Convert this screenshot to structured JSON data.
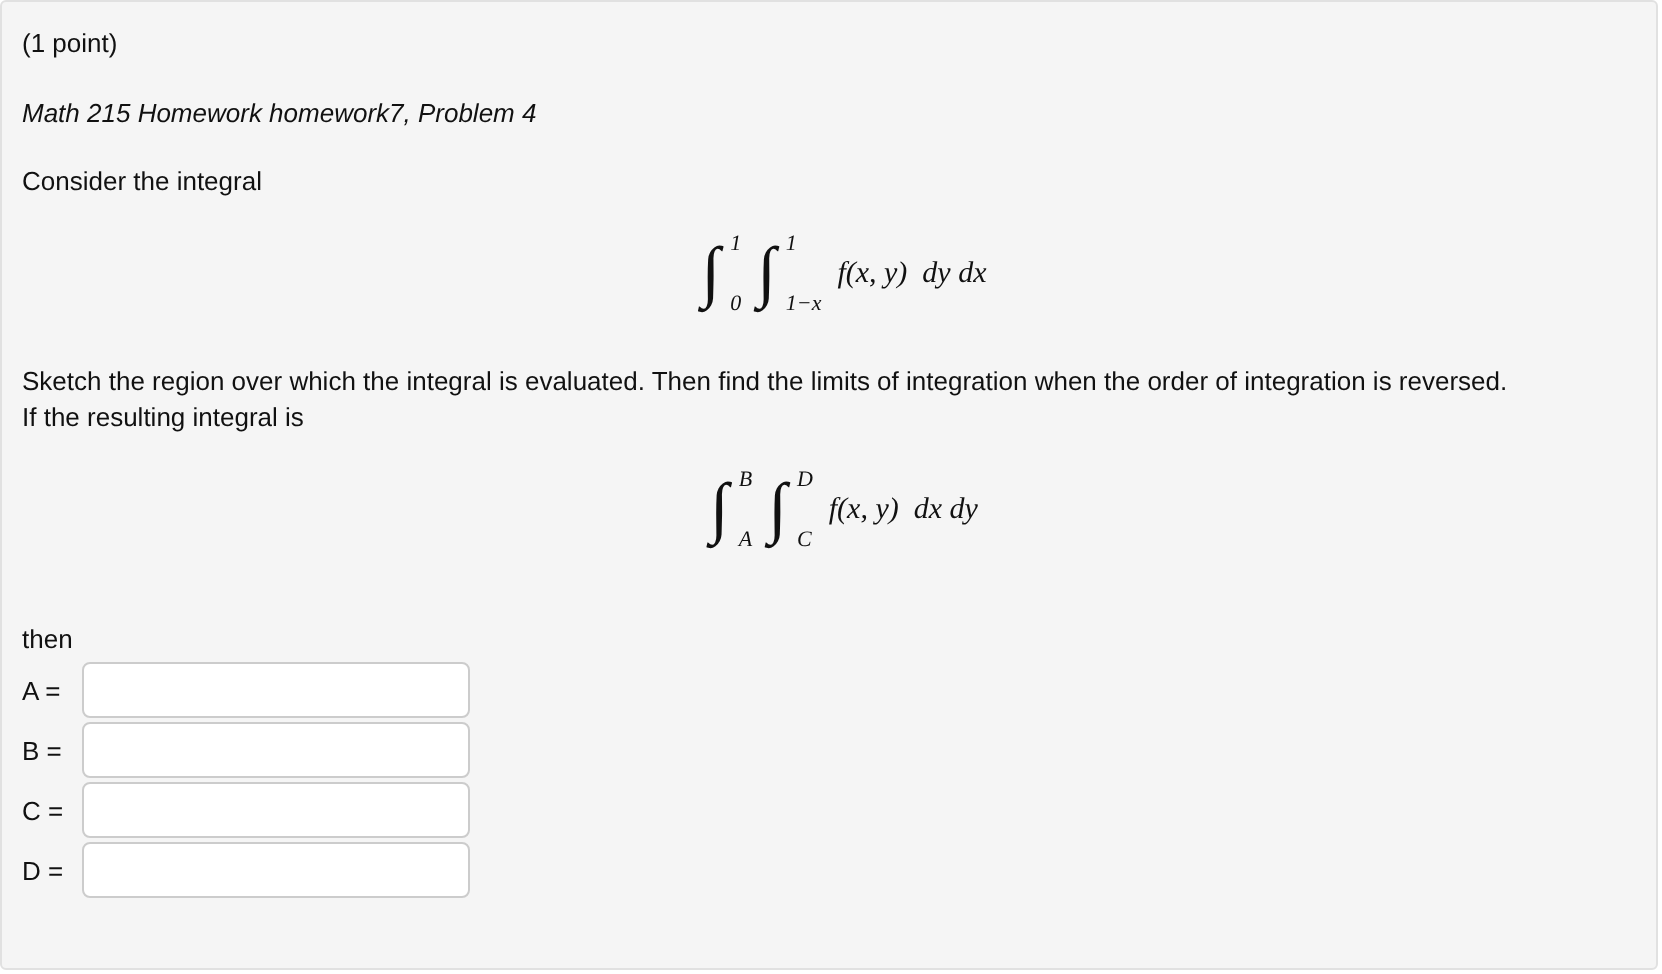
{
  "points": "(1 point)",
  "problem_title": "Math 215 Homework homework7, Problem 4",
  "intro": "Consider the integral",
  "integral_1": {
    "integrals": [
      {
        "sign": "∫",
        "lower": "0",
        "upper": "1"
      },
      {
        "sign": "∫",
        "lower": "1−x",
        "upper": "1"
      }
    ],
    "integrand": "f(x, y)",
    "differentials": "dy dx"
  },
  "question_lines": [
    "Sketch the region over which the integral is evaluated. Then find the limits of integration when the order of integration is reversed.",
    "If the resulting integral is"
  ],
  "integral_2": {
    "integrals": [
      {
        "sign": "∫",
        "lower": "A",
        "upper": "B"
      },
      {
        "sign": "∫",
        "lower": "C",
        "upper": "D"
      }
    ],
    "integrand": "f(x, y)",
    "differentials": "dx dy"
  },
  "then": "then",
  "answers": [
    {
      "label": "A ="
    },
    {
      "label": "B ="
    },
    {
      "label": "C ="
    },
    {
      "label": "D ="
    }
  ]
}
